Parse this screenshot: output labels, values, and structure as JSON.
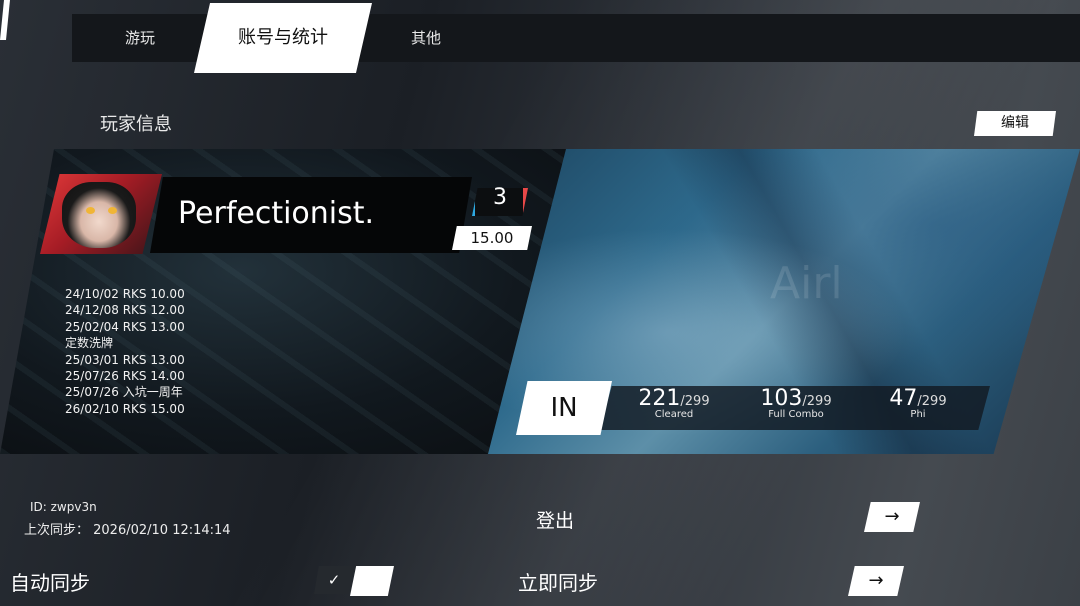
{
  "tabs": {
    "play": "游玩",
    "account": "账号与统计",
    "other": "其他"
  },
  "section": {
    "title": "玩家信息",
    "edit_label": "编辑"
  },
  "player": {
    "name": "Perfectionist.",
    "level": "3",
    "rks": "15.00",
    "history": [
      "24/10/02 RKS 10.00",
      "24/12/08 RKS 12.00",
      "25/02/04 RKS 13.00",
      "定数洗牌",
      "25/03/01 RKS 13.00",
      "25/07/26 RKS 14.00",
      "25/07/26 入坑一周年",
      "26/02/10 RKS 15.00"
    ]
  },
  "stats": {
    "difficulty": "IN",
    "cleared": {
      "value": "221",
      "total": "/299",
      "label": "Cleared"
    },
    "full_combo": {
      "value": "103",
      "total": "/299",
      "label": "Full Combo"
    },
    "phi": {
      "value": "47",
      "total": "/299",
      "label": "Phi"
    }
  },
  "account": {
    "id_text": "ID: zwpv3n",
    "last_sync_text": "上次同步：  2026/02/10 12:14:14",
    "logout_label": "登出",
    "auto_sync_label": "自动同步",
    "sync_now_label": "立即同步",
    "auto_sync_enabled": true
  },
  "icons": {
    "arrow": "→",
    "check": "✓"
  },
  "colors": {
    "accent_blue": "#2ea8e0",
    "accent_red": "#e84848",
    "avatar_red": "#e23a3a"
  }
}
